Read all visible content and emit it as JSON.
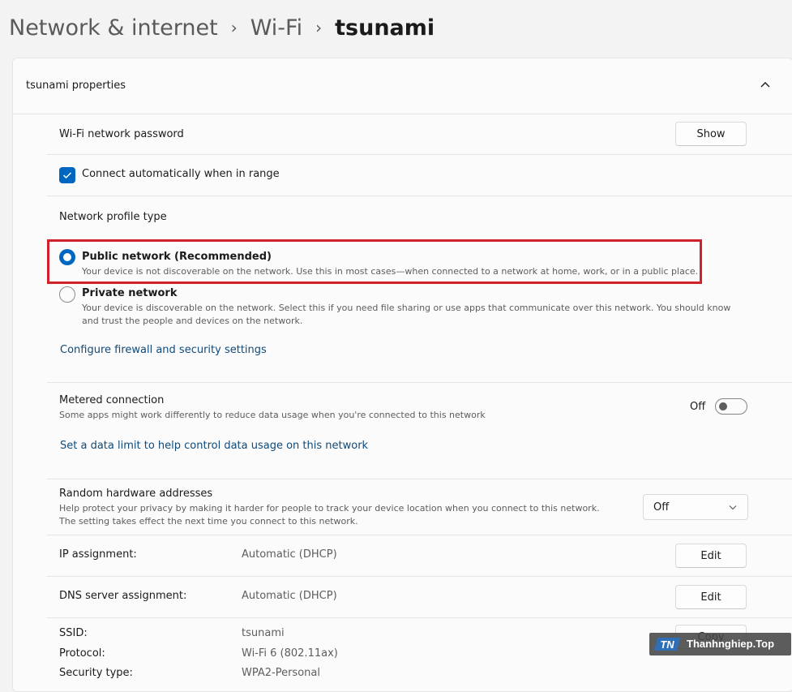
{
  "breadcrumb": {
    "items": [
      "Network & internet",
      "Wi-Fi"
    ],
    "current": "tsunami"
  },
  "properties": {
    "title": "tsunami properties",
    "password_label": "Wi-Fi network password",
    "show_button": "Show",
    "connect_auto_label": "Connect automatically when in range",
    "connect_auto_checked": true,
    "profile_type_label": "Network profile type",
    "public_title": "Public network (Recommended)",
    "public_desc": "Your device is not discoverable on the network. Use this in most cases—when connected to a network at home, work, or in a public place.",
    "public_selected": true,
    "private_title": "Private network",
    "private_desc": "Your device is discoverable on the network. Select this if you need file sharing or use apps that communicate over this network. You should know and trust the people and devices on the network.",
    "firewall_link": "Configure firewall and security settings",
    "metered_title": "Metered connection",
    "metered_desc": "Some apps might work differently to reduce data usage when you're connected to this network",
    "metered_state": "Off",
    "data_limit_link": "Set a data limit to help control data usage on this network",
    "random_hw_title": "Random hardware addresses",
    "random_hw_desc": "Help protect your privacy by making it harder for people to track your device location when you connect to this network. The setting takes effect the next time you connect to this network.",
    "random_hw_value": "Off",
    "ip_label": "IP assignment:",
    "ip_value": "Automatic (DHCP)",
    "ip_edit": "Edit",
    "dns_label": "DNS server assignment:",
    "dns_value": "Automatic (DHCP)",
    "dns_edit": "Edit",
    "ssid_label": "SSID:",
    "ssid_value": "tsunami",
    "protocol_label": "Protocol:",
    "protocol_value": "Wi-Fi 6 (802.11ax)",
    "security_label": "Security type:",
    "security_value": "WPA2-Personal",
    "copy_button": "Copy"
  },
  "watermark": {
    "logo": "TN",
    "text": "Thanhnghiep.Top"
  },
  "colors": {
    "accent": "#0067c0",
    "highlight": "#d1222b",
    "link": "#0f4a7a"
  }
}
